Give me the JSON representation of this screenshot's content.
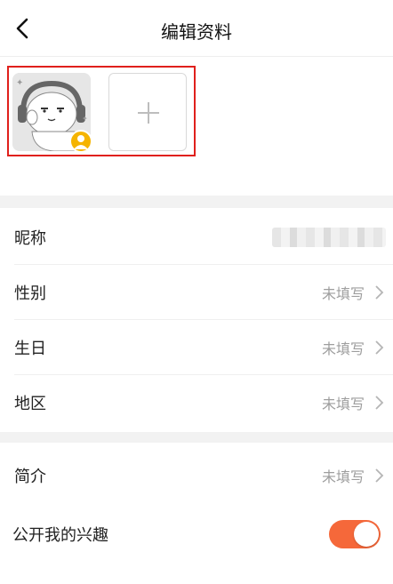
{
  "header": {
    "title": "编辑资料"
  },
  "profile": {
    "nickname_label": "昵称",
    "nickname_value_hidden": true,
    "rows": [
      {
        "label": "性别",
        "value": "未填写"
      },
      {
        "label": "生日",
        "value": "未填写"
      },
      {
        "label": "地区",
        "value": "未填写"
      },
      {
        "label": "简介",
        "value": "未填写"
      }
    ]
  },
  "interest_toggle": {
    "label": "公开我的兴趣",
    "on": true
  },
  "icons": {
    "back": "back-chevron-icon",
    "add": "plus-icon",
    "avatar_badge": "person-badge-icon",
    "row_arrow": "chevron-right-icon"
  },
  "colors": {
    "accent": "#f5683a",
    "highlight_box": "#e0201c",
    "badge": "#f5b400",
    "muted_text": "#9e9e9e",
    "section_gap": "#f2f2f2"
  }
}
